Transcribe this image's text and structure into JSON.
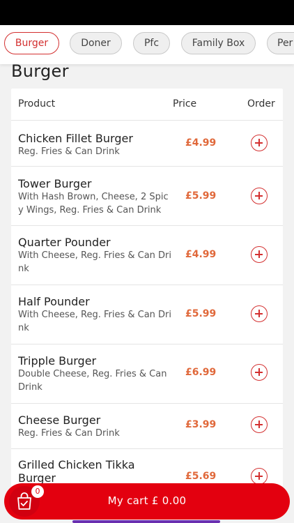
{
  "tabs": [
    {
      "label": "Burger",
      "active": true
    },
    {
      "label": "Doner",
      "active": false
    },
    {
      "label": "Pfc",
      "active": false
    },
    {
      "label": "Family Box",
      "active": false
    },
    {
      "label": "Per",
      "active": false
    }
  ],
  "section_title": "Burger",
  "table_header": {
    "product": "Product",
    "price": "Price",
    "order": "Order"
  },
  "products": [
    {
      "name": "Chicken Fillet Burger",
      "description": "Reg. Fries & Can Drink",
      "price": "£4.99"
    },
    {
      "name": "Tower Burger",
      "description": "With Hash Brown, Cheese, 2 Spicy Wings, Reg. Fries & Can Drink",
      "price": "£5.99"
    },
    {
      "name": "Quarter Pounder",
      "description": "With Cheese, Reg. Fries & Can Drink",
      "price": "£4.99"
    },
    {
      "name": "Half Pounder",
      "description": "With Cheese, Reg. Fries & Can Drink",
      "price": "£5.99"
    },
    {
      "name": "Tripple Burger",
      "description": "Double Cheese, Reg. Fries & Can Drink",
      "price": "£6.99"
    },
    {
      "name": "Cheese Burger",
      "description": "Reg. Fries & Can Drink",
      "price": "£3.99"
    },
    {
      "name": "Grilled Chicken Tikka Burger",
      "description": "",
      "price": "£5.69"
    }
  ],
  "cart": {
    "label": "My cart",
    "total": "£ 0.00",
    "count": "0"
  },
  "colors": {
    "accent": "#d32f2f",
    "price": "#e0683a",
    "cart_bar": "#e3000f"
  },
  "icons": {
    "add": "plus-circle-icon",
    "cart": "shopping-bag-icon"
  }
}
